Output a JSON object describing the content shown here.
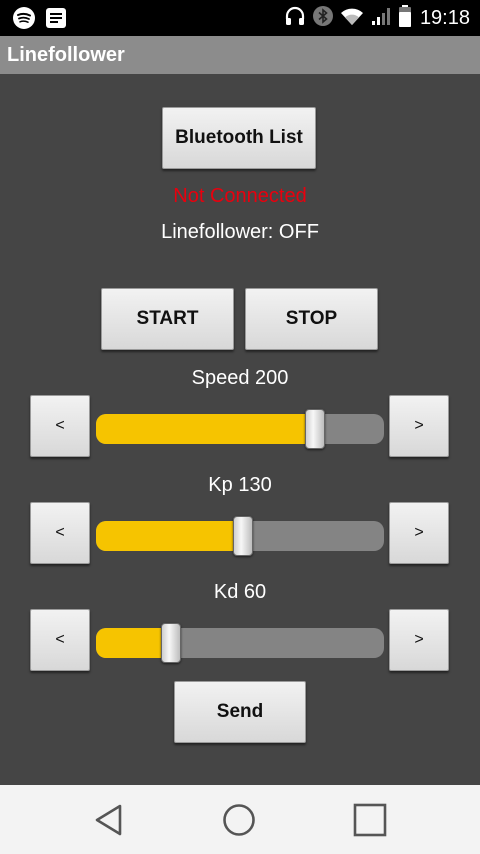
{
  "status_bar": {
    "time": "19:18",
    "left_icons": [
      "spotify-icon",
      "notes-icon"
    ],
    "right_icons": [
      "headphones-icon",
      "bluetooth-icon",
      "wifi-icon",
      "cell-signal-icon",
      "battery-icon"
    ]
  },
  "app": {
    "title": "Linefollower"
  },
  "bluetooth_button": {
    "label": "Bluetooth List"
  },
  "connection_status": {
    "text": "Not Connected",
    "color": "#e8000e"
  },
  "linefollower_status": {
    "text": "Linefollower: OFF"
  },
  "controls": {
    "start_label": "START",
    "stop_label": "STOP"
  },
  "sliders": [
    {
      "name": "Speed",
      "label": "Speed 200",
      "value": 200,
      "fill_fraction": 0.76,
      "decrement_label": "<",
      "increment_label": ">"
    },
    {
      "name": "Kp",
      "label": "Kp 130",
      "value": 130,
      "fill_fraction": 0.51,
      "decrement_label": "<",
      "increment_label": ">"
    },
    {
      "name": "Kd",
      "label": "Kd 60",
      "value": 60,
      "fill_fraction": 0.26,
      "decrement_label": "<",
      "increment_label": ">"
    }
  ],
  "send_button": {
    "label": "Send"
  },
  "colors": {
    "slider_fill": "#f6c400",
    "slider_track": "#848484",
    "background": "#454545",
    "title_bar": "#8c8c8c"
  },
  "nav_bar": {
    "icons": [
      "back-icon",
      "home-icon",
      "recents-icon"
    ]
  }
}
